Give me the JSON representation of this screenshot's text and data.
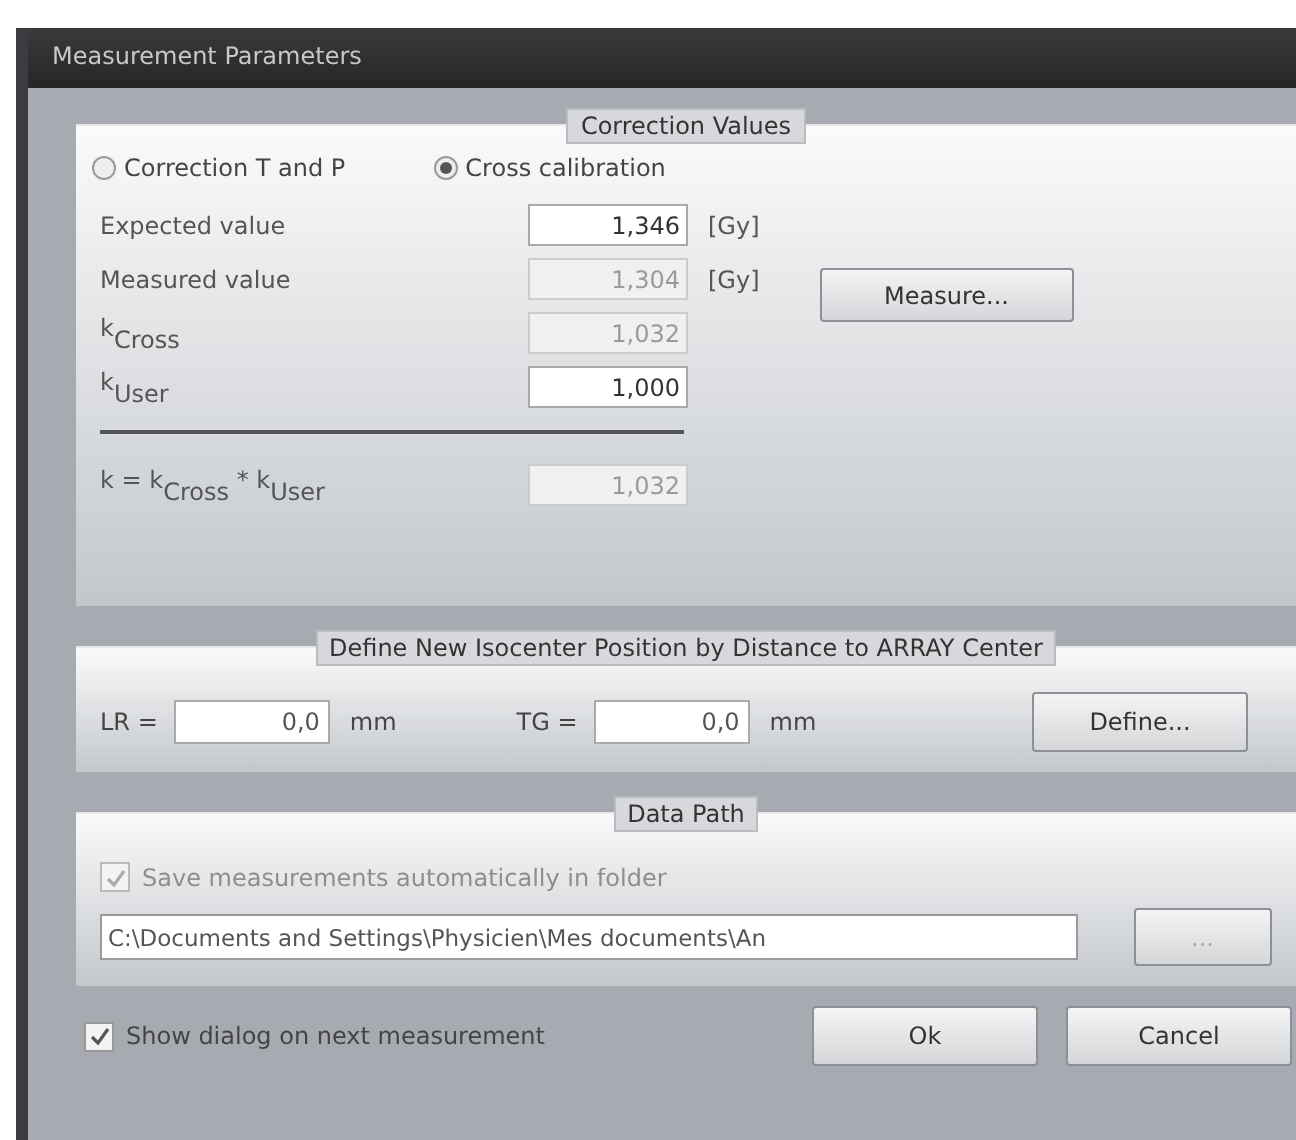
{
  "window": {
    "title": "Measurement Parameters"
  },
  "correction_values": {
    "legend": "Correction Values",
    "options": [
      {
        "label": "Correction T and P",
        "selected": false
      },
      {
        "label": "Cross calibration",
        "selected": true
      }
    ],
    "fields": [
      {
        "label": "Expected value",
        "value": "1,346",
        "unit": "[Gy]",
        "disabled": false
      },
      {
        "label": "Measured value",
        "value": "1,304",
        "unit": "[Gy]",
        "disabled": true
      },
      {
        "label": "k$_{Cross}$",
        "value": "1,032",
        "disabled": true
      },
      {
        "label": "k$_{User}$",
        "value": "1,000",
        "disabled": false
      }
    ],
    "measure_button": "Measure...",
    "result": {
      "label": "k = k$_{Cross}$ * k$_{User}$",
      "value": "1,032",
      "disabled": true
    }
  },
  "isocenter": {
    "legend": "Define New Isocenter Position by Distance to ARRAY Center",
    "fields": [
      {
        "label": "LR =",
        "value": "0,0",
        "unit": "mm"
      },
      {
        "label": "TG =",
        "value": "0,0",
        "unit": "mm"
      }
    ],
    "define_button": "Define..."
  },
  "data_path": {
    "legend": "Data Path",
    "save_option": {
      "label": "Save measurements automatically in folder",
      "checked": true,
      "disabled": true
    },
    "path": "C:\\Documents and Settings\\Physicien\\Mes documents\\An",
    "browse_button": "..."
  },
  "footer": {
    "show_dialog": {
      "label": "Show dialog on next measurement",
      "checked": true
    },
    "buttons": [
      "Ok",
      "Cancel"
    ]
  }
}
